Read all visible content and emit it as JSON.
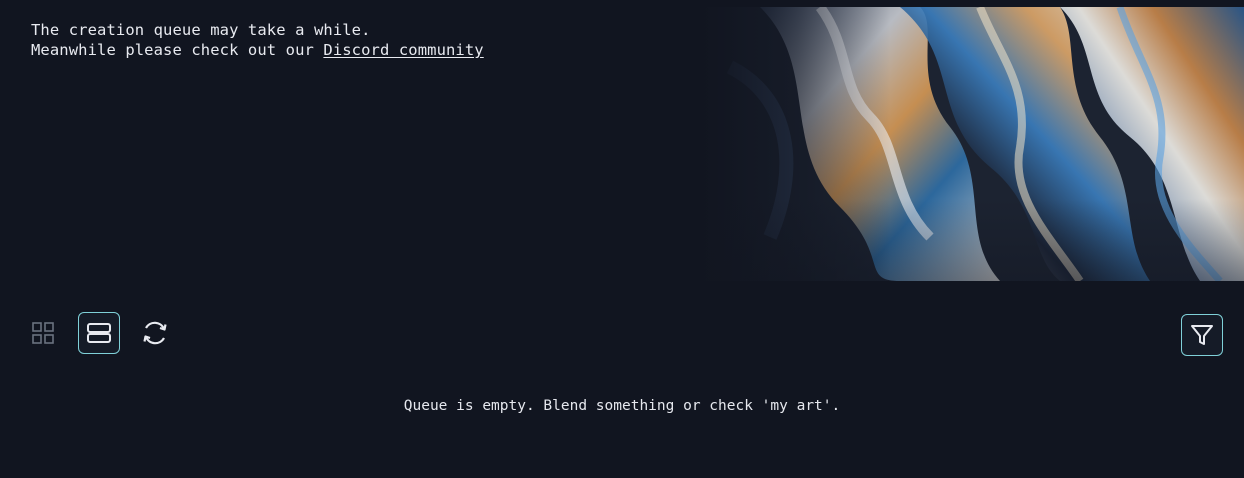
{
  "banner": {
    "line1": "The creation queue may take a while.",
    "line2_prefix": "Meanwhile please check out our ",
    "discord_link": "Discord community"
  },
  "hero_image": {
    "description_icon": "abstract-liquid-chrome-image"
  },
  "toolbar": {
    "grid_view_icon": "grid-icon",
    "list_view_icon": "rows-icon",
    "refresh_icon": "refresh-icon",
    "filter_icon": "filter-icon",
    "accent_color": "#7fd0d8"
  },
  "queue": {
    "empty_message": "Queue is empty. Blend something or check 'my art'."
  }
}
